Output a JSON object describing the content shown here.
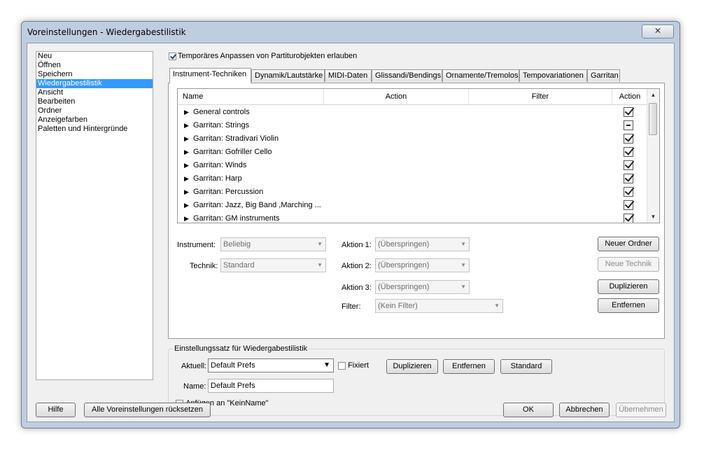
{
  "window": {
    "title": "Voreinstellungen - Wiedergabestilistik",
    "close_glyph": "✕"
  },
  "categories": [
    "Neu",
    "Öffnen",
    "Speichern",
    "Wiedergabestilistik",
    "Ansicht",
    "Bearbeiten",
    "Ordner",
    "Anzeigefarben",
    "Paletten und Hintergründe"
  ],
  "selected_category": 3,
  "top_option": {
    "label": "Temporäres Anpassen von Partiturobjekten erlauben",
    "checked": true
  },
  "tabs": [
    "Instrument-Techniken",
    "Dynamik/Lautstärke",
    "MIDI-Daten",
    "Glissandi/Bendings",
    "Ornamente/Tremolos",
    "Tempovariationen",
    "Garritan"
  ],
  "active_tab": 0,
  "grid": {
    "columns": [
      "Name",
      "Action",
      "Filter",
      "Action"
    ],
    "rows": [
      {
        "name": "General controls",
        "state": "checked"
      },
      {
        "name": "Garritan: Strings",
        "state": "mixed"
      },
      {
        "name": "Garritan: Stradivari Violin",
        "state": "checked"
      },
      {
        "name": "Garritan: Gofriller Cello",
        "state": "checked"
      },
      {
        "name": "Garritan: Winds",
        "state": "checked"
      },
      {
        "name": "Garritan: Harp",
        "state": "checked"
      },
      {
        "name": "Garritan: Percussion",
        "state": "checked"
      },
      {
        "name": "Garritan: Jazz, Big Band ,Marching ...",
        "state": "checked"
      },
      {
        "name": "Garritan: GM instruments",
        "state": "checked"
      }
    ],
    "scroll_up": "▲",
    "scroll_down": "▼",
    "expand_glyph": "▶"
  },
  "form": {
    "instrument_label": "Instrument:",
    "instrument_value": "Beliebig",
    "technique_label": "Technik:",
    "technique_value": "Standard",
    "action1_label": "Aktion 1:",
    "action1_value": "(Überspringen)",
    "action2_label": "Aktion 2:",
    "action2_value": "(Überspringen)",
    "action3_label": "Aktion 3:",
    "action3_value": "(Überspringen)",
    "filter_label": "Filter:",
    "filter_value": "(Kein Filter)",
    "dropdown_glyph": "▼"
  },
  "panel_buttons": {
    "new_folder": "Neuer Ordner",
    "new_technique": "Neue Technik",
    "duplicate": "Duplizieren",
    "remove": "Entfernen"
  },
  "settings_group": {
    "title": "Einstellungssatz für Wiedergabestilistik",
    "current_label": "Aktuell:",
    "current_value": "Default Prefs",
    "fixed_label": "Fixiert",
    "fixed_checked": false,
    "duplicate": "Duplizieren",
    "remove": "Entfernen",
    "standard": "Standard",
    "name_label": "Name:",
    "name_value": "Default Prefs",
    "append_label": "Anfügen an \"KeinName\"",
    "append_checked": false
  },
  "footer": {
    "help": "Hilfe",
    "reset_all": "Alle Voreinstellungen rücksetzen",
    "ok": "OK",
    "cancel": "Abbrechen",
    "apply": "Übernehmen"
  }
}
